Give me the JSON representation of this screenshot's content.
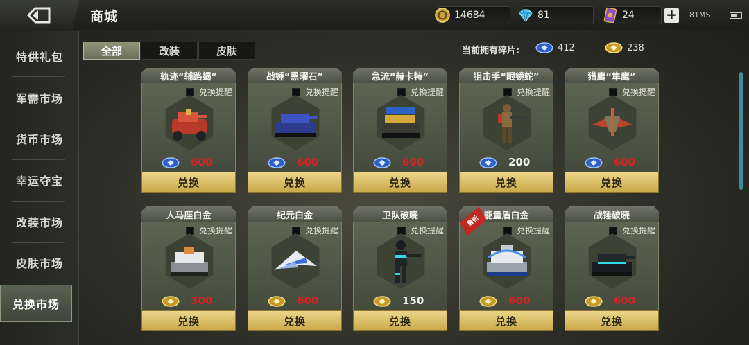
{
  "header": {
    "title": "商城",
    "gold": "14684",
    "diamond": "81",
    "cards": "24",
    "network": "81MS"
  },
  "sidebar": {
    "items": [
      {
        "label": "特供礼包",
        "active": false
      },
      {
        "label": "军需市场",
        "active": false
      },
      {
        "label": "货币市场",
        "active": false
      },
      {
        "label": "幸运夺宝",
        "active": false
      },
      {
        "label": "改装市场",
        "active": false
      },
      {
        "label": "皮肤市场",
        "active": false
      },
      {
        "label": "兑换市场",
        "active": true
      }
    ]
  },
  "tabs": [
    {
      "label": "全部",
      "active": true
    },
    {
      "label": "改装",
      "active": false
    },
    {
      "label": "皮肤",
      "active": false
    }
  ],
  "fragments": {
    "label": "当前拥有碎片:",
    "blue": "412",
    "gold": "238"
  },
  "items": [
    {
      "name": "轨迹“辅路蝎”",
      "remind": "兑换提醒",
      "price": "600",
      "currency": "blue",
      "affordable": false,
      "button": "兑换",
      "unit": "red-tank",
      "ribbon": false
    },
    {
      "name": "战锤“黑曜石”",
      "remind": "兑换提醒",
      "price": "600",
      "currency": "blue",
      "affordable": false,
      "button": "兑换",
      "unit": "blue-tank",
      "ribbon": false
    },
    {
      "name": "急流“赫卡特”",
      "remind": "兑换提醒",
      "price": "600",
      "currency": "blue",
      "affordable": false,
      "button": "兑换",
      "unit": "yellow-tank",
      "ribbon": false
    },
    {
      "name": "狙击手“眼镜蛇”",
      "remind": "兑换提醒",
      "price": "200",
      "currency": "blue",
      "affordable": true,
      "button": "兑换",
      "unit": "sniper",
      "ribbon": false
    },
    {
      "name": "猎鹰“隼鹰”",
      "remind": "兑换提醒",
      "price": "600",
      "currency": "blue",
      "affordable": false,
      "button": "兑换",
      "unit": "red-jet",
      "ribbon": false
    },
    {
      "name": "人马座白金",
      "remind": "兑换提醒",
      "price": "300",
      "currency": "gold",
      "affordable": false,
      "button": "兑换",
      "unit": "white-tank",
      "ribbon": false
    },
    {
      "name": "纪元白金",
      "remind": "兑换提醒",
      "price": "600",
      "currency": "gold",
      "affordable": false,
      "button": "兑换",
      "unit": "white-jet",
      "ribbon": false
    },
    {
      "name": "卫队破晓",
      "remind": "兑换提醒",
      "price": "150",
      "currency": "gold",
      "affordable": true,
      "button": "兑换",
      "unit": "cyan-soldier",
      "ribbon": false
    },
    {
      "name": "能量盾白金",
      "remind": "兑换提醒",
      "price": "600",
      "currency": "gold",
      "affordable": false,
      "button": "兑换",
      "unit": "white-shield-tank",
      "ribbon": true,
      "ribbon_text": "最新"
    },
    {
      "name": "战锤破晓",
      "remind": "兑换提醒",
      "price": "600",
      "currency": "gold",
      "affordable": false,
      "button": "兑换",
      "unit": "cyan-tank",
      "ribbon": false
    }
  ],
  "colors": {
    "price_insufficient": "#d52222",
    "price_ok": "#f2f2ea",
    "button_gold": "#d9bd64",
    "active_tab": "#7e846a",
    "blue_fragment": "#3d6fd8",
    "gold_fragment": "#d8b43a"
  }
}
